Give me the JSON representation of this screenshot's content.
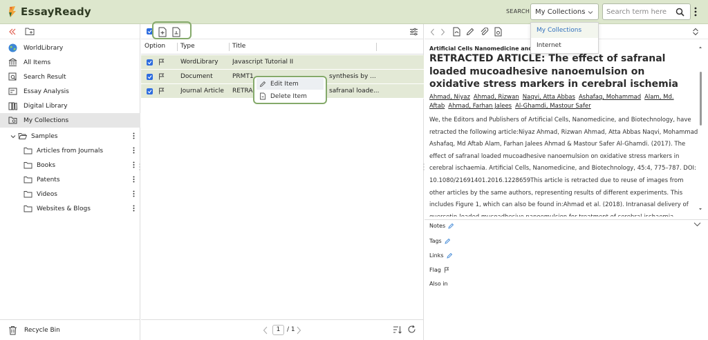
{
  "app": {
    "name": "EssayReady"
  },
  "search": {
    "label": "SEARCH",
    "scope": "My Collections",
    "placeholder": "Search term here",
    "options": [
      "My Collections",
      "Internet"
    ]
  },
  "sidebar": {
    "items": [
      {
        "label": "WorldLibrary",
        "icon": "globe-icon"
      },
      {
        "label": "All Items",
        "icon": "library-icon"
      },
      {
        "label": "Search Result",
        "icon": "search-result-icon"
      },
      {
        "label": "Essay Analysis",
        "icon": "analysis-icon"
      },
      {
        "label": "Digital Library",
        "icon": "digital-library-icon"
      },
      {
        "label": "My Collections",
        "icon": "collections-icon"
      }
    ],
    "tree": {
      "root": "Samples",
      "children": [
        "Articles from Journals",
        "Books",
        "Patents",
        "Videos",
        "Websites & Blogs"
      ]
    },
    "recycle": "Recycle Bin"
  },
  "table": {
    "headers": {
      "option": "Option",
      "type": "Type",
      "title": "Title"
    },
    "rows": [
      {
        "type": "WordLibrary",
        "title": "Javascript Tutorial II"
      },
      {
        "type": "Document",
        "title": "PRMT1 ... synthesis by ..."
      },
      {
        "type": "Journal Article",
        "title": "RETRACTED ARTICLE: The effect of safranal loade..."
      }
    ],
    "row_titles_visible": [
      {
        "left": "Javascript Tutorial II",
        "right": ""
      },
      {
        "left": "PRMT1",
        "right": "synthesis by ..."
      },
      {
        "left": "RETRAC",
        "right": "safranal loade..."
      }
    ]
  },
  "context_menu": {
    "items": [
      "Edit Item",
      "Delete Item"
    ]
  },
  "pager": {
    "current": "1",
    "total": "/ 1"
  },
  "detail": {
    "journal": "Artificial Cells Nanomedicine and Bi",
    "title": "RETRACTED ARTICLE: The effect of safranal loaded mucoadhesive nanoemulsion on oxidative stress markers in cerebral ischemia",
    "authors": [
      "Ahmad, Niyaz",
      "Ahmad, Rizwan",
      "Naqvi, Atta Abbas",
      "Ashafaq, Mohammad",
      "Alam, Md. Aftab",
      "Ahmad, Farhan Jalees",
      "Al-Ghamdi, Mastour Safer"
    ],
    "abstract": "We, the Editors and Publishers of Artificial Cells, Nanomedicine, and Biotechnology, have retracted the following article:Niyaz Ahmad, Rizwan Ahmad, Atta Abbas Naqvi, Mohammad Ashafaq, Md Aftab Alam, Farhan Jalees Ahmad & Mastour Safer Al-Ghamdi. (2017). The effect of safranal loaded mucoadhesive nanoemulsion on oxidative stress markers in cerebral ischaemia. Artificial Cells, Nanomedicine, and Biotechnology, 45:4, 775–787. DOI: 10.1080/21691401.2016.1228659This article is retracted due to reuse of images from other articles by the same authors, representing results of different experiments. This includes Figure 1, which can also be found in:Ahmad et al. (2018). Intranasal delivery of quercetin-loaded mucoadhesive nanoemulsion for treatment of cerebral ischaemia. Artificial Cells, Nanomedicine...",
    "meta": {
      "notes": "Notes",
      "tags": "Tags",
      "links": "Links",
      "flag": "Flag",
      "also_in": "Also in"
    }
  },
  "colors": {
    "topbar": "#dde7cd",
    "row_selected": "#e3e9d6",
    "accent_green": "#84a96a",
    "link_blue": "#2f6fbd",
    "checkbox_blue": "#2d6cdf"
  }
}
